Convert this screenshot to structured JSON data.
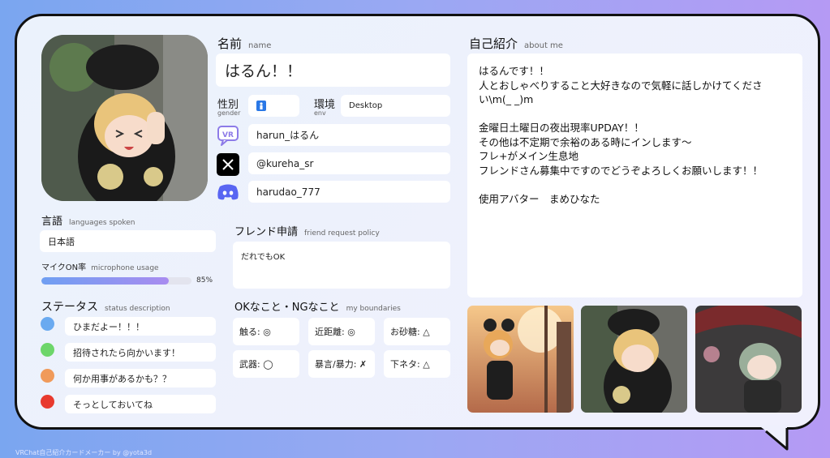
{
  "footer": "VRChat自己紹介カードメーカー by @yota3d",
  "name": {
    "label_jp": "名前",
    "label_en": "name",
    "value": "はるん！！"
  },
  "gender": {
    "label_jp": "性別",
    "label_en": "gender",
    "icon": "person-icon"
  },
  "env": {
    "label_jp": "環境",
    "label_en": "env",
    "value": "Desktop"
  },
  "social": {
    "vrchat": "harun_はるん",
    "x": "@kureha_sr",
    "discord": "harudao_777"
  },
  "languages": {
    "label_jp": "言語",
    "label_en": "languages spoken",
    "value": "日本語"
  },
  "mic": {
    "label_jp": "マイクON率",
    "label_en": "microphone usage",
    "percent_text": "85%",
    "value": 85
  },
  "status": {
    "label_jp": "ステータス",
    "label_en": "status description",
    "items": [
      {
        "color": "#6aaaf0",
        "text": "ひまだよー！！！"
      },
      {
        "color": "#6dd66a",
        "text": "招待されたら向かいます！"
      },
      {
        "color": "#f09a5a",
        "text": "何か用事があるかも？？"
      },
      {
        "color": "#e83a2e",
        "text": "そっとしておいてね"
      }
    ]
  },
  "friend": {
    "label_jp": "フレンド申請",
    "label_en": "friend request policy",
    "value": "だれでもOK"
  },
  "boundaries": {
    "label_jp": "OKなこと・NGなこと",
    "label_en": "my boundaries",
    "items": [
      "触る: ◎",
      "近距離: ◎",
      "お砂糖: △",
      "武器: ◯",
      "暴言/暴力: ✗",
      "下ネタ: △"
    ]
  },
  "about": {
    "label_jp": "自己紹介",
    "label_en": "about me",
    "lines": [
      "はるんです！！",
      "人とおしゃべりすること大好きなので気軽に話しかけてくださ",
      "い\\m(_ _)m",
      "",
      "金曜日土曜日の夜出現率UPDAY！！",
      "その他は不定期で余裕のある時にインします〜",
      "フレ+がメイン生息地",
      "フレンドさん募集中ですのでどうぞよろしくお願いします！！",
      "",
      "使用アバター　まめひなた"
    ]
  }
}
